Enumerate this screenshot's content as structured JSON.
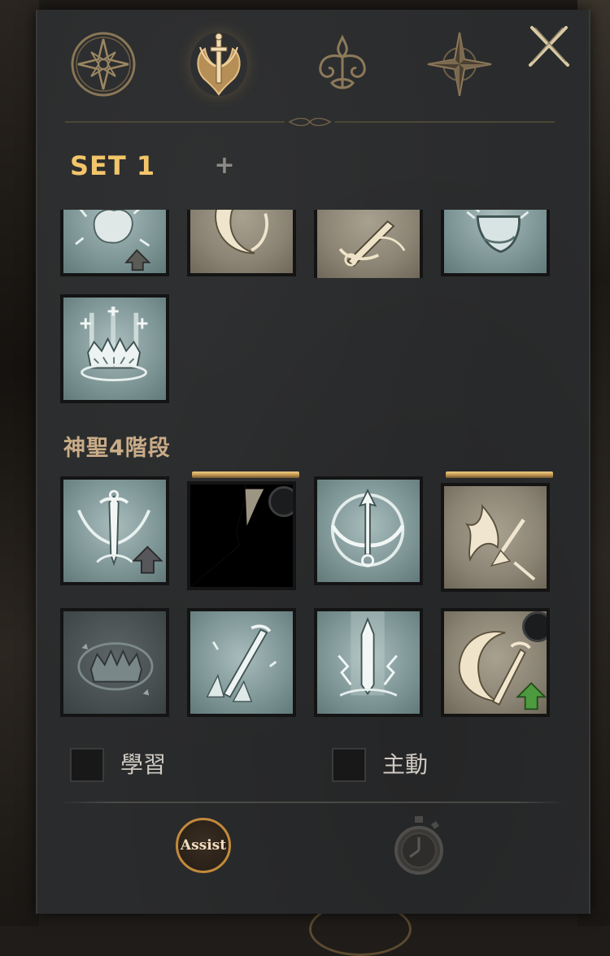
{
  "tabs": [
    {
      "name": "compass-star-tab",
      "icon": "compass-star-icon",
      "active": false
    },
    {
      "name": "winged-sword-tab",
      "icon": "winged-sword-icon",
      "active": true
    },
    {
      "name": "fleur-ornament-tab",
      "icon": "fleur-ornament-icon",
      "active": false
    },
    {
      "name": "compass-rose-tab",
      "icon": "compass-rose-icon",
      "active": false
    }
  ],
  "close_icon": "close-icon",
  "set": {
    "label": "SET 1",
    "add_label": "+"
  },
  "section": {
    "label": "神聖4階段"
  },
  "upper_skills": [
    {
      "icon": "shattered-fist-icon",
      "tone": "teal",
      "upgrade_arrow": true
    },
    {
      "icon": "crescent-slash-icon",
      "tone": "tan"
    },
    {
      "icon": "sword-swing-icon",
      "tone": "tan"
    },
    {
      "icon": "frost-shield-icon",
      "tone": "teal"
    },
    {
      "icon": "holy-crown-aura-icon",
      "tone": "teal"
    }
  ],
  "tier4_skills": [
    {
      "icon": "winged-bow-sword-icon",
      "tone": "teal",
      "upgrade_arrow": true
    },
    {
      "icon": "redacted-skill-icon",
      "tone": "redacted",
      "equipped_bar": true,
      "slot_badge": true
    },
    {
      "icon": "winged-arrow-circle-icon",
      "tone": "teal"
    },
    {
      "icon": "flaming-arrow-icon",
      "tone": "tan",
      "equipped_bar": true
    },
    {
      "icon": "dark-crown-icon",
      "tone": "dim"
    },
    {
      "icon": "crystal-sword-icon",
      "tone": "teal"
    },
    {
      "icon": "lightning-sword-icon",
      "tone": "teal"
    },
    {
      "icon": "crescent-sword-icon",
      "tone": "tan",
      "slot_badge": true,
      "green_arrow": true
    }
  ],
  "options": {
    "learn_label": "學習",
    "active_label": "主動"
  },
  "footer": {
    "assist_label": "Assist",
    "timer_icon": "stopwatch-icon"
  },
  "colors": {
    "accent_gold": "#f2c56a",
    "section_tan": "#c9ac88",
    "panel_bg": "#2a2b2c"
  }
}
